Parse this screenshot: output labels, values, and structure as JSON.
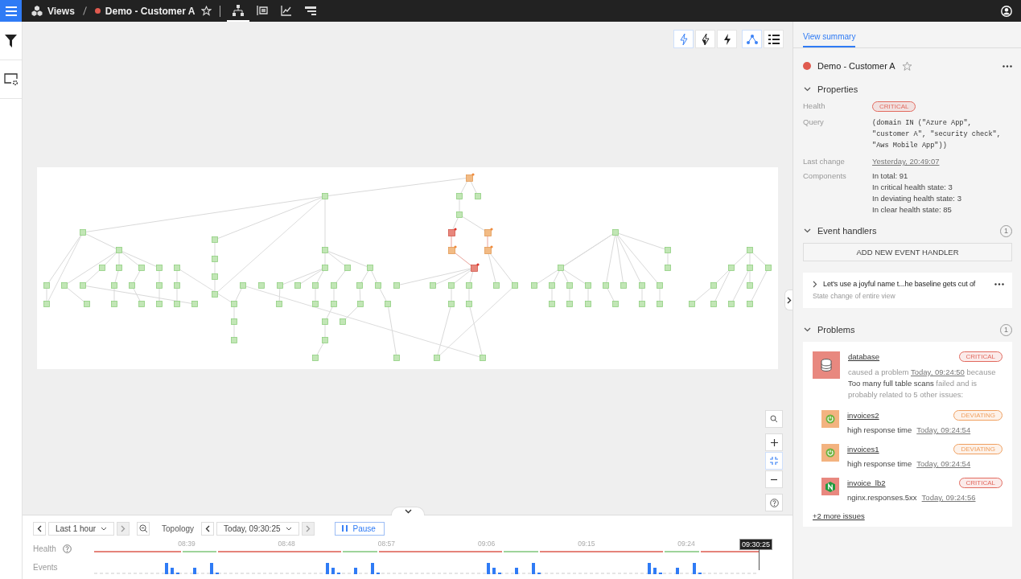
{
  "top_bar": {
    "breadcrumb": [
      {
        "label": "Views",
        "kind": "views"
      },
      {
        "label": "Demo - Customer A",
        "kind": "view",
        "color": "#e05a4f",
        "starred": false
      }
    ],
    "view_modes": [
      {
        "kind": "topology",
        "selected": true
      },
      {
        "kind": "list",
        "selected": false
      },
      {
        "kind": "chart",
        "selected": false
      },
      {
        "kind": "events",
        "selected": false
      }
    ]
  },
  "graph_toolbar": [
    {
      "kind": "bolt-outline",
      "selected": true
    },
    {
      "kind": "bolt-half",
      "selected": false
    },
    {
      "kind": "bolt-filled",
      "selected": false
    },
    {
      "kind": "topology",
      "selected": true
    },
    {
      "kind": "list",
      "selected": false
    }
  ],
  "zoom_controls": [
    {
      "kind": "search",
      "selected": false
    },
    {
      "kind": "zoom-in",
      "selected": false
    },
    {
      "kind": "fit",
      "selected": true
    },
    {
      "kind": "zoom-out",
      "selected": false
    },
    {
      "kind": "help",
      "selected": false
    }
  ],
  "side_panel": {
    "tabs": [
      {
        "label": "View summary",
        "selected": true
      }
    ],
    "view": {
      "name": "Demo - Customer A",
      "color": "#e05a4f",
      "starred": false
    },
    "properties": {
      "title": "Properties",
      "expanded": true,
      "rows": [
        {
          "label": "Health",
          "kind": "badge",
          "value": "CRITICAL",
          "color": "#e26a5f"
        },
        {
          "label": "Query",
          "kind": "code",
          "value": "(domain IN (\"Azure App\", \"customer A\", \"security check\", \"Aws Mobile App\"))"
        },
        {
          "label": "Last change",
          "kind": "link",
          "value": "Yesterday, 20:49:07"
        },
        {
          "label": "Components",
          "kind": "lines",
          "lines": [
            "In total: 91",
            "In critical health state: 3",
            "In deviating health state: 3",
            "In clear health state: 85"
          ]
        }
      ]
    },
    "event_handlers": {
      "title": "Event handlers",
      "count": "1",
      "expanded": true,
      "add_button": "ADD NEW EVENT HANDLER",
      "items": [
        {
          "name": "Let's use a joyful name t...he baseline gets cut of",
          "description": "State change of entire view",
          "expanded": false
        }
      ]
    },
    "problems": {
      "title": "Problems",
      "count": "1",
      "expanded": true,
      "items": [
        {
          "name": "database",
          "kind": "database",
          "color": "#e26a5f",
          "badge": "CRITICAL",
          "description": {
            "prefix": "caused a problem",
            "time": "Today, 09:24:50",
            "middle": "because",
            "cause": "Too many full table scans",
            "suffix": "failed and is probably related to 5 other issues:"
          },
          "related": [
            {
              "name": "invoices2",
              "kind": "spring",
              "color": "#f0a060",
              "badge": "DEVIATING",
              "metric": "high response time",
              "time": "Today, 09:24:54"
            },
            {
              "name": "invoices1",
              "kind": "spring",
              "color": "#f0a060",
              "badge": "DEVIATING",
              "metric": "high response time",
              "time": "Today, 09:24:54"
            },
            {
              "name": "invoice_lb2",
              "kind": "nginx",
              "color": "#e26a5f",
              "badge": "CRITICAL",
              "metric": "nginx.responses.5xx",
              "time": "Today, 09:24:56"
            }
          ],
          "more": "+2 more issues"
        }
      ]
    }
  },
  "timeline": {
    "range": "Last 1 hour",
    "topology_label": "Topology",
    "time": "Today, 09:30:25",
    "pause": "Pause",
    "health_label": "Health",
    "events_label": "Events",
    "ticks": [
      "08:39",
      "08:48",
      "08:57",
      "09:06",
      "09:15",
      "09:24"
    ],
    "health_segments": [
      {
        "color": "#e5837a"
      },
      {
        "color": "#9ed49a"
      },
      {
        "color": "#e5837a"
      },
      {
        "color": "#9ed49a"
      },
      {
        "color": "#e5837a"
      },
      {
        "color": "#9ed49a"
      },
      {
        "color": "#e5837a"
      },
      {
        "color": "#9ed49a"
      },
      {
        "color": "#e5837a"
      }
    ],
    "cursor": "09:30:25"
  }
}
